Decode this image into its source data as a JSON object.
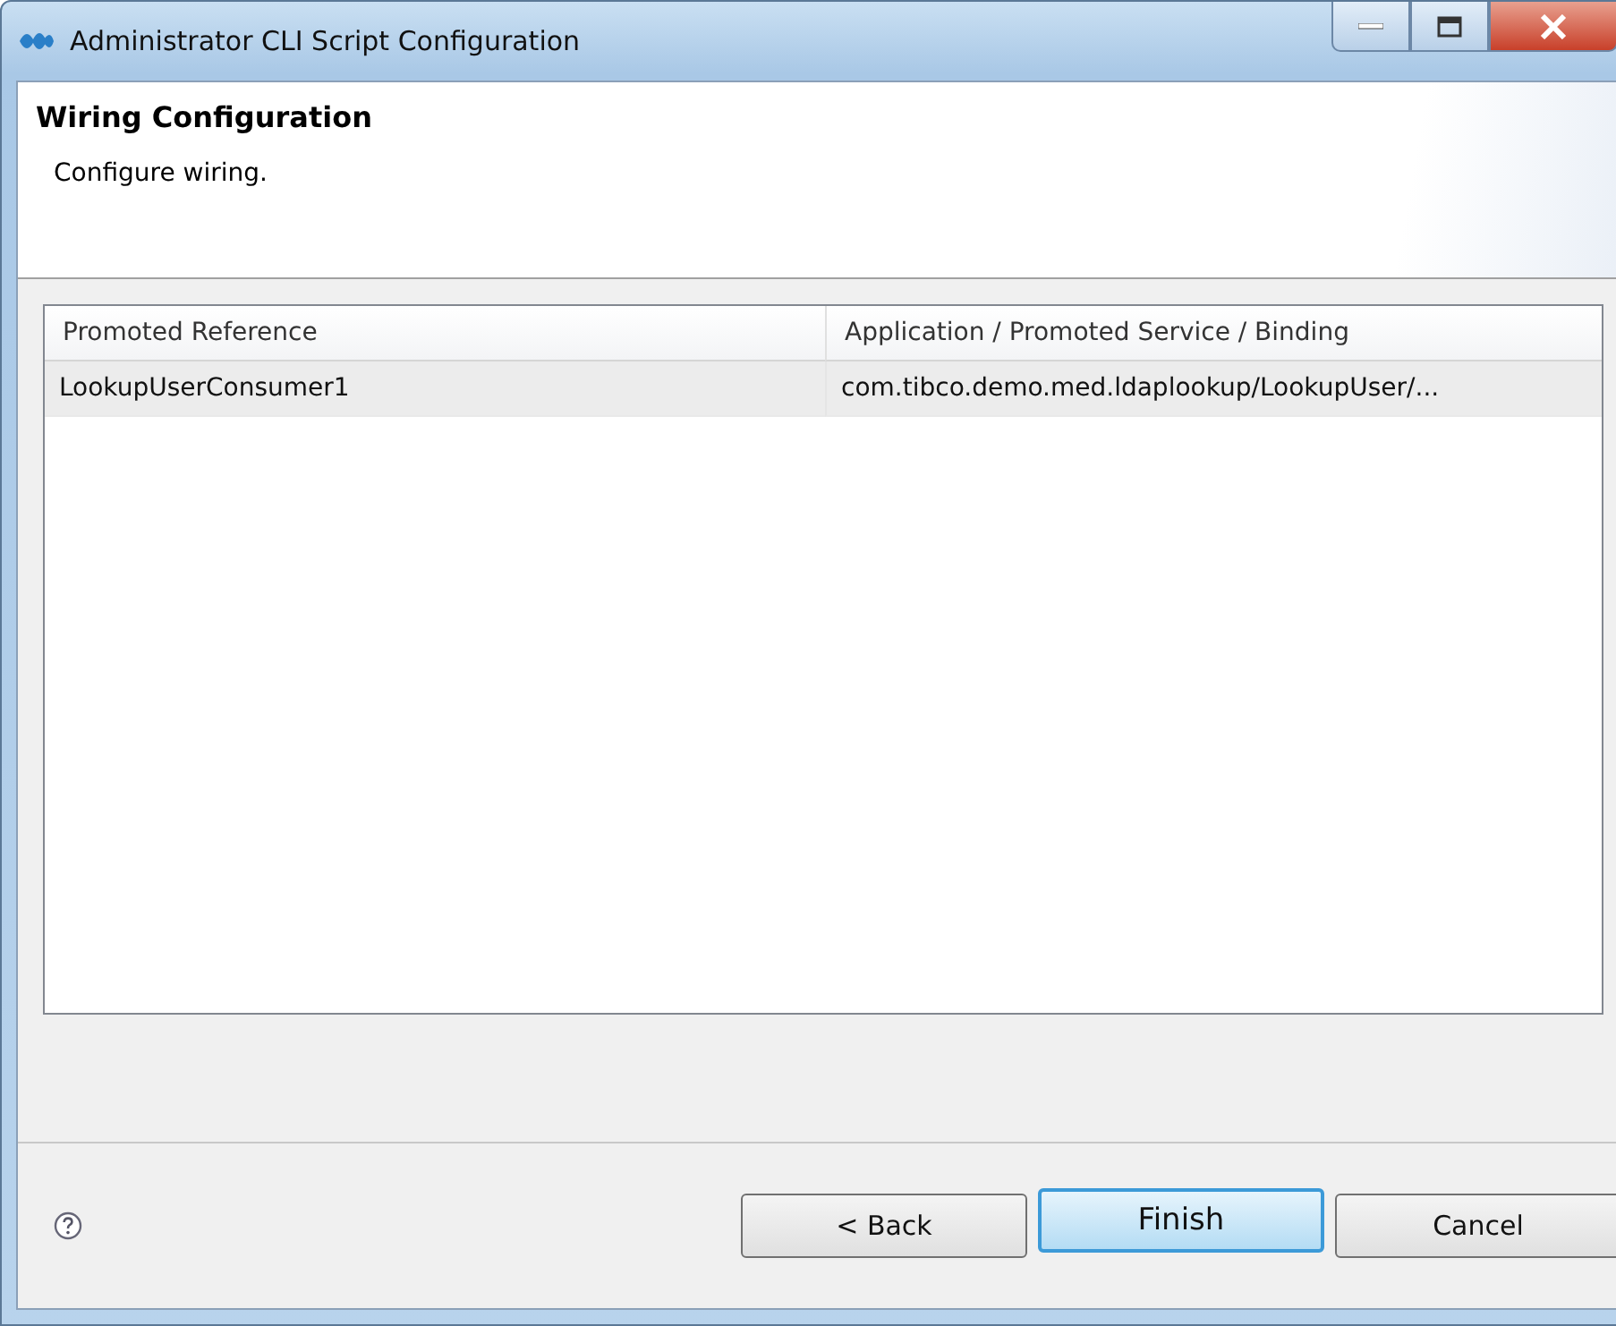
{
  "window": {
    "title": "Administrator CLI Script Configuration"
  },
  "header": {
    "title": "Wiring Configuration",
    "description": "Configure wiring."
  },
  "table": {
    "columns": [
      "Promoted Reference",
      "Application / Promoted Service / Binding"
    ],
    "rows": [
      {
        "cells": [
          "LookupUserConsumer1",
          "com.tibco.demo.med.ldaplookup/LookupUser/..."
        ],
        "selected": true
      }
    ]
  },
  "buttons": [
    {
      "label": "< Back",
      "default": false
    },
    {
      "label": "Finish",
      "default": true
    },
    {
      "label": "Cancel",
      "default": false
    }
  ]
}
